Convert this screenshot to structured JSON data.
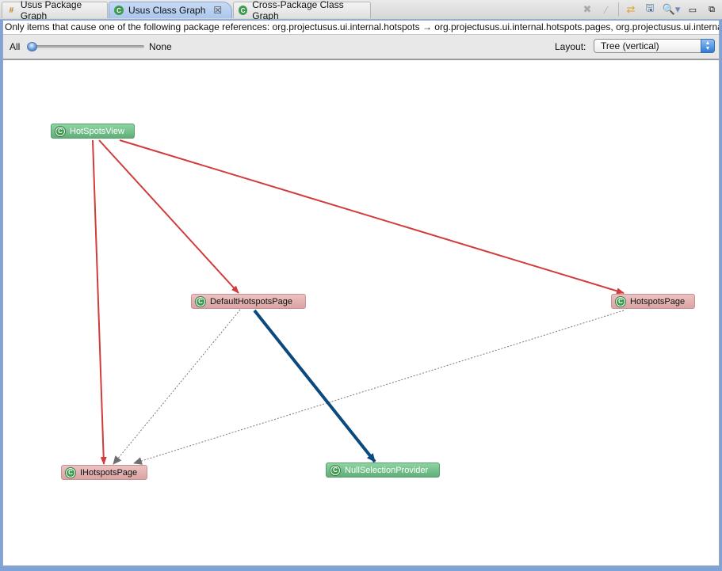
{
  "tabs": [
    {
      "label": "Usus Package Graph",
      "icon": "package-graph-icon",
      "active": false
    },
    {
      "label": "Usus Class Graph",
      "icon": "class-graph-icon",
      "active": true,
      "closable": true
    },
    {
      "label": "Cross-Package Class Graph",
      "icon": "cross-package-graph-icon",
      "active": false
    }
  ],
  "toolbar": {
    "buttons": [
      "remove-icon",
      "clear-icon",
      "refresh-icon",
      "save-icon",
      "zoom-icon",
      "minimize-icon",
      "maximize-icon"
    ]
  },
  "info": {
    "text": "Only items that cause one of the following package references: org.projectusus.ui.internal.hotspots → org.projectusus.ui.internal.hotspots.pages, org.projectusus.ui.internal.hotspots.pages"
  },
  "filter": {
    "label_all": "All",
    "label_none": "None",
    "slider_value": 0,
    "layout_label": "Layout:",
    "layout_value": "Tree (vertical)"
  },
  "graph": {
    "nodes": [
      {
        "id": "HotSpotsView",
        "label": "HotSpotsView",
        "kind": "green"
      },
      {
        "id": "DefaultHotspotsPage",
        "label": "DefaultHotspotsPage",
        "kind": "pink"
      },
      {
        "id": "HotspotsPage",
        "label": "HotspotsPage",
        "kind": "pink"
      },
      {
        "id": "IHotspotsPage",
        "label": "IHotspotsPage",
        "kind": "pink"
      },
      {
        "id": "NullSelectionProvider",
        "label": "NullSelectionProvider",
        "kind": "green"
      }
    ],
    "edges": [
      {
        "from": "HotSpotsView",
        "to": "IHotspotsPage",
        "style": "cross-package",
        "color": "#d13c3c"
      },
      {
        "from": "HotSpotsView",
        "to": "DefaultHotspotsPage",
        "style": "cross-package",
        "color": "#d13c3c"
      },
      {
        "from": "HotSpotsView",
        "to": "HotspotsPage",
        "style": "cross-package",
        "color": "#d13c3c"
      },
      {
        "from": "DefaultHotspotsPage",
        "to": "IHotspotsPage",
        "style": "implements",
        "color": "#7a7a7a"
      },
      {
        "from": "HotspotsPage",
        "to": "IHotspotsPage",
        "style": "implements",
        "color": "#7a7a7a"
      },
      {
        "from": "DefaultHotspotsPage",
        "to": "NullSelectionProvider",
        "style": "selected",
        "color": "#0b4a7e"
      }
    ]
  },
  "colors": {
    "node_green": "#6dbb85",
    "node_pink": "#e1b0b0",
    "edge_red": "#d13c3c",
    "edge_blue": "#0b4a7e",
    "edge_gray": "#7a7a7a",
    "tab_active": "#b4cdf0"
  }
}
